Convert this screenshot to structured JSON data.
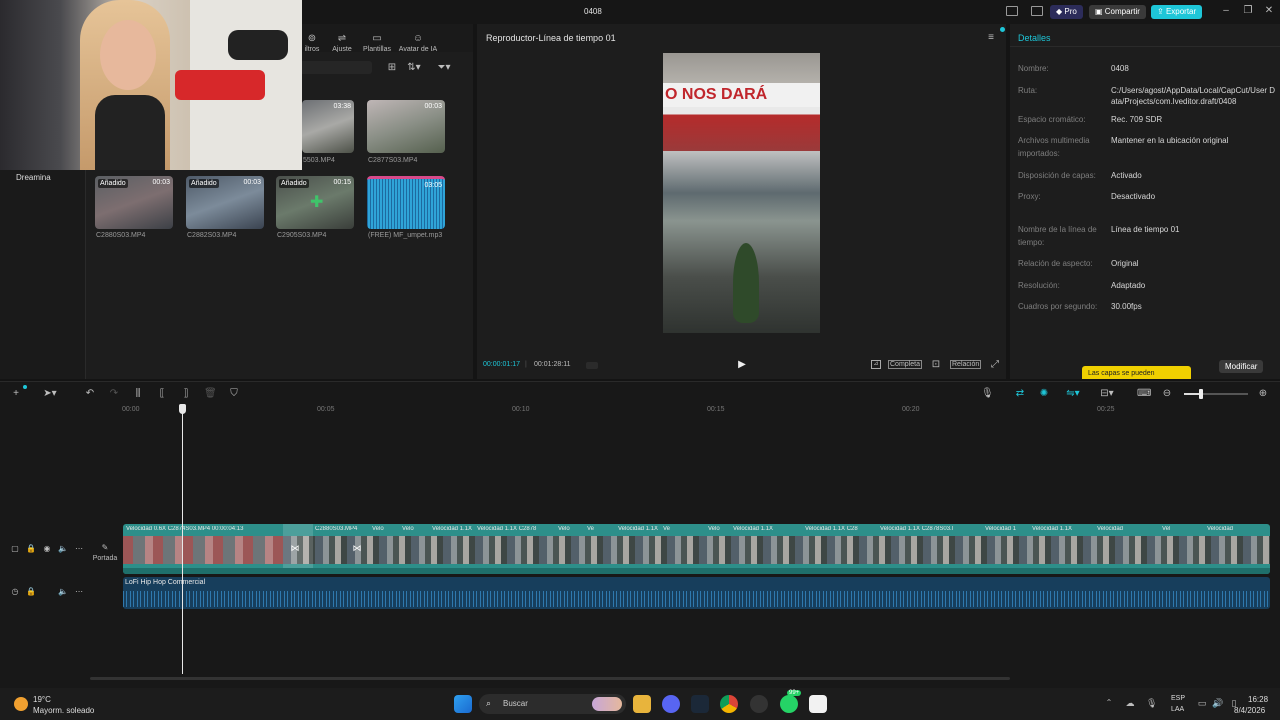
{
  "window": {
    "title": "0408",
    "pro_label": "Pro",
    "share_label": "Compartir",
    "export_label": "Exportar"
  },
  "toolbar": {
    "items": [
      "iltros",
      "Ajuste",
      "Plantillas",
      "Avatar de IA"
    ]
  },
  "sidebar": {
    "dreamina_label": "Dreamina"
  },
  "media": {
    "row1": [
      {
        "name": "5503.MP4",
        "duration": "03:38"
      },
      {
        "name": "C2877S03.MP4",
        "duration": "00:03"
      }
    ],
    "row2": [
      {
        "tag": "Añadido",
        "name": "C2880S03.MP4",
        "duration": "00:03"
      },
      {
        "tag": "Añadido",
        "name": "C2882S03.MP4",
        "duration": "00:03"
      },
      {
        "tag": "Añadido",
        "name": "C2905S03.MP4",
        "duration": "00:15"
      },
      {
        "tag": "",
        "name": "(FREE) MF_umpet.mp3",
        "duration": "03:05"
      }
    ]
  },
  "player": {
    "title": "Reproductor-Línea de tiempo 01",
    "sign_text": "O NOS DARÁ",
    "current_time": "00:00:01:17",
    "total_time": "00:01:28:11",
    "full_label": "Completa",
    "ratio_label": "Relación"
  },
  "details": {
    "title": "Detalles",
    "rows": [
      {
        "label": "Nombre:",
        "value": "0408"
      },
      {
        "label": "Ruta:",
        "value": "C:/Users/agost/AppData/Local/CapCut/User Data/Projects/com.lveditor.draft/0408"
      },
      {
        "label": "Espacio cromático:",
        "value": "Rec. 709 SDR"
      },
      {
        "label": "Archivos multimedia importados:",
        "value": "Mantener en la ubicación original"
      },
      {
        "label": "Disposición de capas:",
        "value": "Activado"
      },
      {
        "label": "Proxy:",
        "value": "Desactivado"
      },
      {
        "label": "Nombre de la línea de tiempo:",
        "value": "Línea de tiempo 01"
      },
      {
        "label": "Relación de aspecto:",
        "value": "Original"
      },
      {
        "label": "Resolución:",
        "value": "Adaptado"
      },
      {
        "label": "Cuadros por segundo:",
        "value": "30.00fps"
      }
    ],
    "tooltip": "Las capas se pueden",
    "modify_label": "Modificar"
  },
  "timeline": {
    "ruler": [
      "00:00",
      "00:05",
      "00:10",
      "00:15",
      "00:20",
      "00:25"
    ],
    "cover_label": "Portada",
    "segments": [
      "Velocidad 0.6X  C2874S03.MP4  00:00:04:13",
      "C2880S03.MP4",
      "Velo",
      "Velo",
      "Velocidad 1.1X",
      "Velocidad 1.1X  C2878",
      "Velo",
      "Ve",
      "Velocidad 1.1X",
      "Ve",
      "Velo",
      "Velocidad 1.1X",
      "Velocidad 1.1X  C28",
      "Velocidad 1.1X  C2878S03.l",
      "Velocidad 1",
      "Velocidad 1.1X",
      "Velocidad",
      "Vel",
      "Velocidad"
    ],
    "audio_label": "LoFi Hip Hop Commercial"
  },
  "taskbar": {
    "weather_temp": "19°C",
    "weather_text": "Mayorm. soleado",
    "search_placeholder": "Buscar",
    "lang_top": "ESP",
    "lang_bottom": "LAA",
    "time": "16:28",
    "date": "8/4/2026",
    "badge": "99+"
  },
  "colors": {
    "accent": "#1ec6d8",
    "export": "#1ec6d8",
    "pro": "#3a3aa8",
    "tooltip": "#f0d000",
    "track": "#2d8f8a",
    "audio": "#1a5c8c"
  }
}
